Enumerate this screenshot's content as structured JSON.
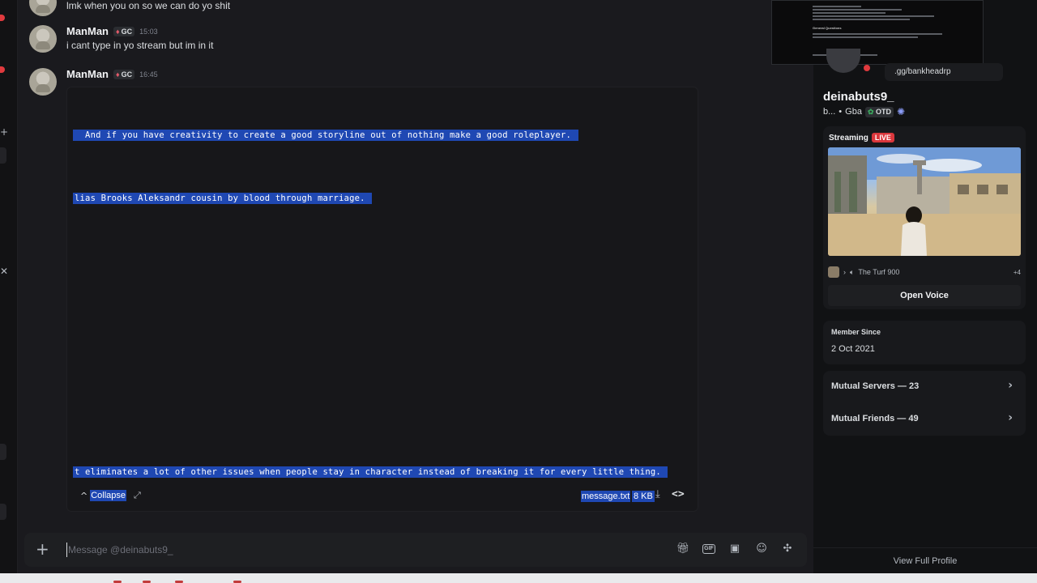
{
  "messages": [
    {
      "text": "lmk when you on so we can do yo shit"
    },
    {
      "author": "ManMan",
      "tag": "GC",
      "time": "15:03",
      "text": "i cant type in yo stream but im in it"
    },
    {
      "author": "ManMan",
      "tag": "GC",
      "time": "16:45"
    }
  ],
  "attachment": {
    "lines": [
      "  And if you have creativity to create a good storyline out of nothing make a good roleplayer. ",
      "lias Brooks Aleksandr cousin by blood through marriage. ",
      "t eliminates a lot of other issues when people stay in character instead of breaking it for every little thing. "
    ],
    "collapse_label": "Collapse",
    "file_name": "message.txt",
    "file_size": "8 KB"
  },
  "composer": {
    "placeholder": "Message @deinabuts9_",
    "gif_label": "GIF"
  },
  "profile": {
    "custom_link": ".gg/bankheadrp",
    "display_name": "deinabuts9_",
    "username_short": "b...",
    "pronoun_region": "Gba",
    "tag": "OTD",
    "pip_title": "General Questions",
    "streaming_label": "Streaming",
    "live_label": "LIVE",
    "voice_channel": "The Turf 900",
    "voice_count": "+4",
    "open_voice_label": "Open Voice",
    "member_since_label": "Member Since",
    "member_since_date": "2 Oct 2021",
    "mutual_servers": "Mutual Servers — 23",
    "mutual_friends": "Mutual Friends — 49",
    "view_full_label": "View Full Profile"
  },
  "colors": {
    "selection": "#1f48b3",
    "live": "#da373c",
    "status_dnd": "#e03a3e"
  }
}
